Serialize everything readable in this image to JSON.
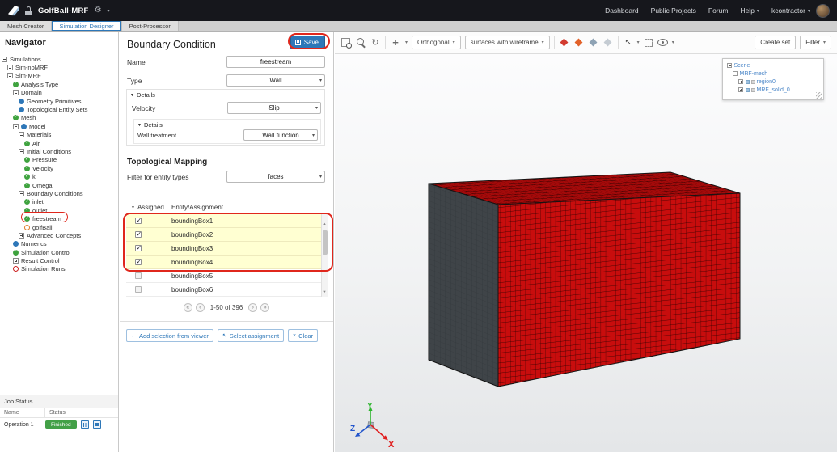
{
  "topbar": {
    "title": "GolfBall-MRF",
    "links": [
      {
        "label": "Dashboard",
        "caret": false
      },
      {
        "label": "Public Projects",
        "caret": false
      },
      {
        "label": "Forum",
        "caret": false
      },
      {
        "label": "Help",
        "caret": true
      },
      {
        "label": "kcontractor",
        "caret": true
      }
    ]
  },
  "tabs": [
    {
      "label": "Mesh Creator",
      "active": false
    },
    {
      "label": "Simulation Designer",
      "active": true
    },
    {
      "label": "Post-Processor",
      "active": false
    }
  ],
  "navigator": {
    "title": "Navigator",
    "tree": [
      {
        "label": "Simulations",
        "level": 0,
        "expander": "minus",
        "icon": "none"
      },
      {
        "label": "Sim-noMRF",
        "level": 1,
        "expander": "plus",
        "icon": "none"
      },
      {
        "label": "Sim-MRF",
        "level": 1,
        "expander": "minus",
        "icon": "none"
      },
      {
        "label": "Analysis Type",
        "level": 2,
        "expander": "none",
        "icon": "check"
      },
      {
        "label": "Domain",
        "level": 2,
        "expander": "minus",
        "icon": "none"
      },
      {
        "label": "Geometry Primitives",
        "level": 3,
        "expander": "none",
        "icon": "dot"
      },
      {
        "label": "Topological Entity Sets",
        "level": 3,
        "expander": "none",
        "icon": "dot"
      },
      {
        "label": "Mesh",
        "level": 2,
        "expander": "none",
        "icon": "check"
      },
      {
        "label": "Model",
        "level": 2,
        "expander": "minus",
        "icon": "dot"
      },
      {
        "label": "Materials",
        "level": 3,
        "expander": "minus",
        "icon": "none"
      },
      {
        "label": "Air",
        "level": 4,
        "expander": "none",
        "icon": "check"
      },
      {
        "label": "Initial Conditions",
        "level": 3,
        "expander": "minus",
        "icon": "none"
      },
      {
        "label": "Pressure",
        "level": 4,
        "expander": "none",
        "icon": "check"
      },
      {
        "label": "Velocity",
        "level": 4,
        "expander": "none",
        "icon": "check"
      },
      {
        "label": "k",
        "level": 4,
        "expander": "none",
        "icon": "check"
      },
      {
        "label": "Omega",
        "level": 4,
        "expander": "none",
        "icon": "check"
      },
      {
        "label": "Boundary Conditions",
        "level": 3,
        "expander": "minus",
        "icon": "none"
      },
      {
        "label": "inlet",
        "level": 4,
        "expander": "none",
        "icon": "check"
      },
      {
        "label": "outlet",
        "level": 4,
        "expander": "none",
        "icon": "check"
      },
      {
        "label": "freestream",
        "level": 4,
        "expander": "none",
        "icon": "check"
      },
      {
        "label": "golfBall",
        "level": 4,
        "expander": "none",
        "icon": "circle-orange"
      },
      {
        "label": "Advanced Concepts",
        "level": 3,
        "expander": "plus",
        "icon": "none"
      },
      {
        "label": "Numerics",
        "level": 2,
        "expander": "none",
        "icon": "dot"
      },
      {
        "label": "Simulation Control",
        "level": 2,
        "expander": "none",
        "icon": "check"
      },
      {
        "label": "Result Control",
        "level": 2,
        "expander": "plus",
        "icon": "none"
      },
      {
        "label": "Simulation Runs",
        "level": 2,
        "expander": "none",
        "icon": "circle-red"
      }
    ]
  },
  "job_status": {
    "title": "Job Status",
    "columns": [
      "Name",
      "Status"
    ],
    "rows": [
      {
        "name": "Operation 1",
        "status": "Finished",
        "status_color": "#43a047"
      }
    ]
  },
  "panel": {
    "title": "Boundary Condition",
    "save_label": "Save",
    "name_label": "Name",
    "name_value": "freestream",
    "type_label": "Type",
    "type_value": "Wall",
    "details_label": "Details",
    "velocity_label": "Velocity",
    "velocity_value": "Slip",
    "inner_details_label": "Details",
    "wall_treatment_label": "Wall treatment",
    "wall_treatment_value": "Wall function",
    "topo_heading": "Topological Mapping",
    "filter_label": "Filter for entity types",
    "filter_value": "faces",
    "table": {
      "columns": [
        "Assigned",
        "Entity/Assignment"
      ],
      "rows": [
        {
          "entity": "boundingBox1",
          "checked": true,
          "highlight": true
        },
        {
          "entity": "boundingBox2",
          "checked": true,
          "highlight": true
        },
        {
          "entity": "boundingBox3",
          "checked": true,
          "highlight": true
        },
        {
          "entity": "boundingBox4",
          "checked": true,
          "highlight": true
        },
        {
          "entity": "boundingBox5",
          "checked": false,
          "highlight": false
        },
        {
          "entity": "boundingBox6",
          "checked": false,
          "highlight": false
        }
      ]
    },
    "pagination": "1-50 of 396",
    "footer_buttons": [
      {
        "label": "Add selection from viewer",
        "icon": "arrow-left"
      },
      {
        "label": "Select assignment",
        "icon": "cursor"
      },
      {
        "label": "Clear",
        "icon": "x"
      }
    ]
  },
  "viewer": {
    "toolbar": {
      "icons_a": [
        {
          "name": "zoom-window-icon",
          "type": "magbox"
        },
        {
          "name": "zoom-icon",
          "type": "mag"
        },
        {
          "name": "reset-view-icon",
          "type": "refresh"
        }
      ],
      "projection_label": "Orthogonal",
      "render_mode_label": "surfaces with wireframe",
      "icons_b": [
        {
          "name": "select-volume-icon",
          "type": "d-red"
        },
        {
          "name": "select-face-icon",
          "type": "d-orange"
        },
        {
          "name": "select-edge-icon",
          "type": "d-gray"
        },
        {
          "name": "select-node-icon",
          "type": "d-lightgray"
        }
      ],
      "icons_c": [
        {
          "name": "pick-cursor-icon",
          "type": "cursor",
          "caret": true
        },
        {
          "name": "box-select-icon",
          "type": "dashbox",
          "caret": false
        },
        {
          "name": "visibility-eye-icon",
          "type": "eye",
          "caret": true
        }
      ],
      "create_set_label": "Create set",
      "filter_label": "Filter"
    },
    "scene_tree": [
      {
        "label": "Scene",
        "level": 0,
        "expander": "minus",
        "icons": 0
      },
      {
        "label": "MRF-mesh",
        "level": 1,
        "expander": "minus",
        "icons": 0
      },
      {
        "label": "region0",
        "level": 2,
        "expander": "plus",
        "icons": 2
      },
      {
        "label": "MRF_solid_0",
        "level": 2,
        "expander": "plus",
        "icons": 2
      }
    ],
    "axes": {
      "x": "X",
      "y": "Y",
      "z": "Z"
    }
  },
  "colors": {
    "accent_blue": "#2d77b8",
    "mesh_red": "#c80d0d",
    "mesh_top_red": "#a50a0a",
    "mesh_dark_side": "#3f4448",
    "finished_green": "#43a047",
    "annotation_red": "#e0271c",
    "highlight_yellow": "#ffffd2"
  }
}
